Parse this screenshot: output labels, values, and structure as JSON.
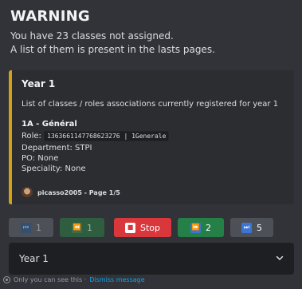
{
  "warning": {
    "title": "WARNING",
    "line1": "You have 23 classes not assigned.",
    "line2": "A list of them is present in the lasts pages."
  },
  "embed": {
    "accent_color": "#d4a017",
    "title": "Year 1",
    "description": "List of classes / roles associations currently registered for year 1",
    "field": {
      "name": "1A - Général",
      "role_label": "Role:",
      "role_code": "1363661147768623276 | 1Generale",
      "department": "Department: STPI",
      "po": "PO: None",
      "speciality": "Speciality: None"
    },
    "footer": "picasso2005 - Page 1/5"
  },
  "buttons": [
    {
      "label": "1",
      "icon": "first-page-icon",
      "style": "disabled"
    },
    {
      "label": "1",
      "icon": "previous-page-icon",
      "style": "disabled-green"
    },
    {
      "label": "Stop",
      "icon": "stop-icon",
      "style": "danger"
    },
    {
      "label": "2",
      "icon": "next-page-icon",
      "style": "success"
    },
    {
      "label": "5",
      "icon": "last-page-icon",
      "style": "secondary"
    }
  ],
  "select": {
    "value": "Year 1"
  },
  "ephemeral": {
    "text": "Only you can see this · ",
    "dismiss": "Dismiss message"
  }
}
